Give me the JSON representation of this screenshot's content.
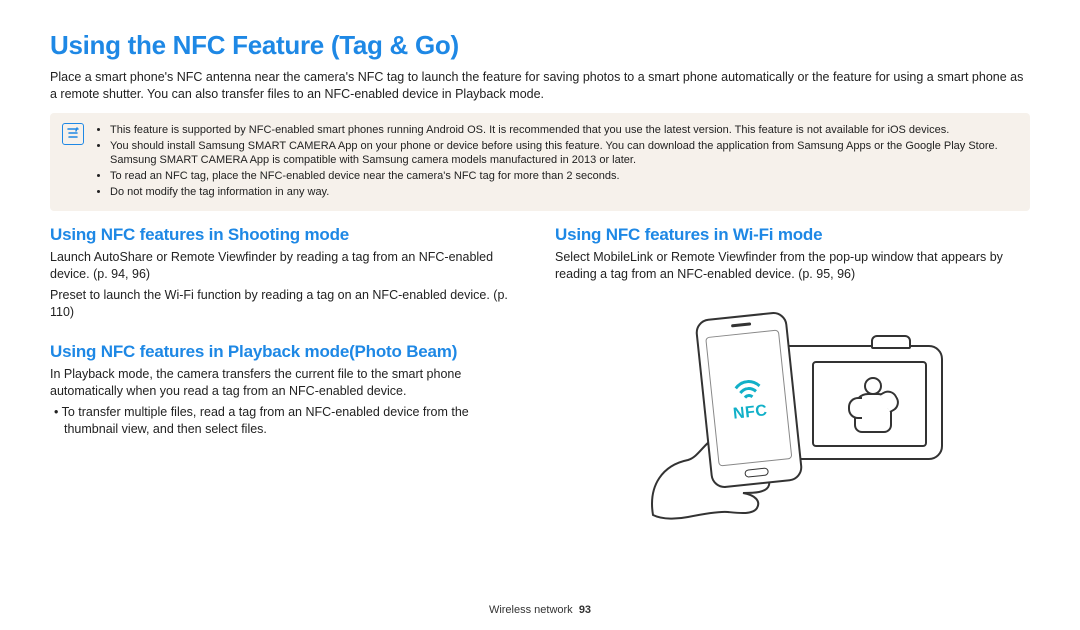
{
  "title": "Using the NFC Feature (Tag & Go)",
  "intro": "Place a smart phone's NFC antenna near the camera's NFC tag to launch the feature for saving photos to a smart phone automatically or the feature for using a smart phone as a remote shutter. You can also transfer files to an NFC-enabled device in Playback mode.",
  "info": {
    "items": [
      "This feature is supported by NFC-enabled smart phones running Android OS. It is recommended that you use the latest version. This feature is not available for iOS devices.",
      "You should install Samsung SMART CAMERA App on your phone or device before using this feature. You can download the application from Samsung Apps or the Google Play Store. Samsung SMART CAMERA App is compatible with Samsung camera models manufactured in 2013 or later.",
      "To read an NFC tag, place the NFC-enabled device near the camera's NFC tag for more than 2 seconds.",
      "Do not modify the tag information in any way."
    ]
  },
  "left": {
    "s1_title": "Using NFC features in Shooting mode",
    "s1_p1": "Launch AutoShare or Remote Viewfinder by reading a tag from an NFC-enabled device. (p. 94, 96)",
    "s1_p2": "Preset to launch the Wi-Fi function by reading a tag on an NFC-enabled device. (p. 110)",
    "s2_title": "Using NFC features in Playback mode(Photo Beam)",
    "s2_p1": "In Playback mode, the camera transfers the current file to the smart phone automatically when you read a tag from an NFC-enabled device.",
    "s2_b1": "To transfer multiple files, read a tag from an NFC-enabled device from the thumbnail view, and then select files."
  },
  "right": {
    "s1_title": "Using NFC features in Wi-Fi mode",
    "s1_p1": "Select MobileLink or Remote Viewfinder from the pop-up window that appears by reading a tag from an NFC-enabled device. (p. 95, 96)",
    "nfc_label": "NFC"
  },
  "footer": {
    "section": "Wireless network",
    "page": "93"
  }
}
